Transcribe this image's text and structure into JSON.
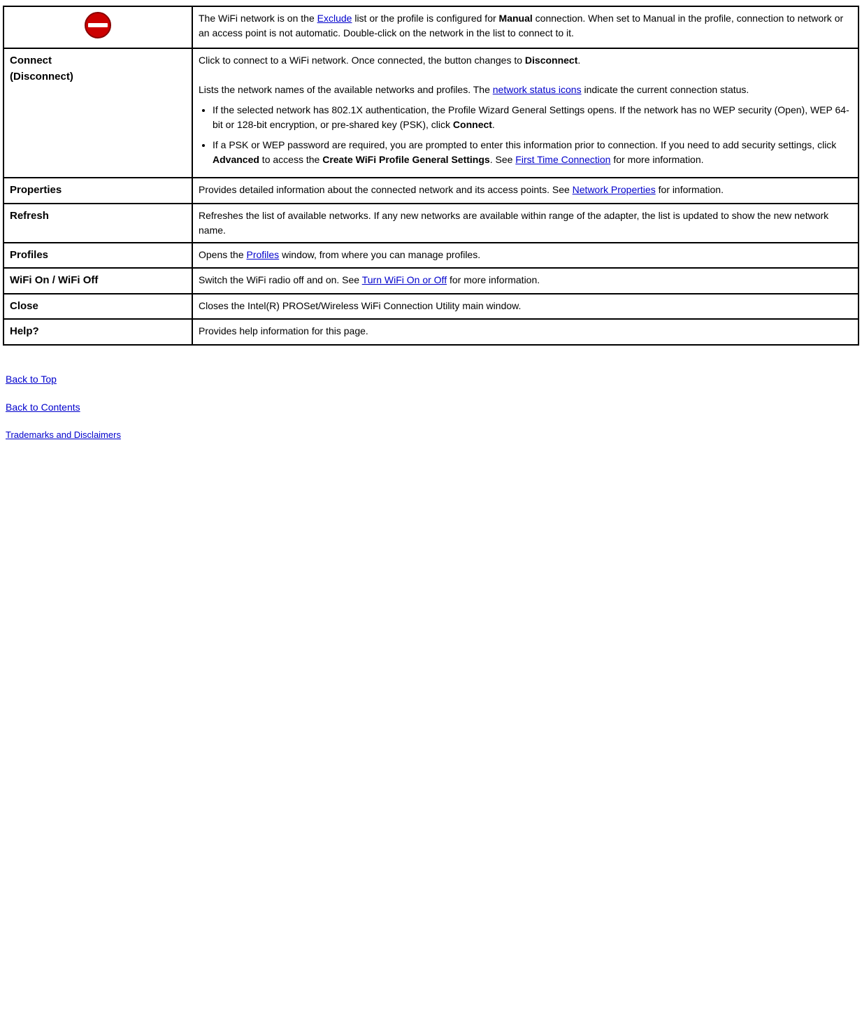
{
  "table": {
    "rows": [
      {
        "type": "icon-row",
        "icon_label": "no-entry-icon",
        "description_html": "The WiFi network is on the <a href='#'>Exclude</a> list or the profile is configured for <strong>Manual</strong> connection. When set to Manual in the profile, connection to network or an access point is not automatic. Double-click on the network in the list to connect to it."
      },
      {
        "type": "label-row",
        "label": "Connect (Disconnect)",
        "description_intro": "Click to connect to a WiFi network. Once connected, the button changes to",
        "description_disconnect": "Disconnect",
        "description_mid": "Lists the network names of the available networks and profiles. The",
        "description_link1_text": "network status icons",
        "description_link1_href": "#",
        "description_mid2": "indicate the current connection status.",
        "bullets": [
          "If the selected network has 802.1X authentication, the Profile Wizard General Settings opens. If the network has no WEP security (Open), WEP 64-bit or 128-bit encryption, or pre-shared key (PSK), click <strong>Connect</strong>.",
          "If a PSK or WEP password are required, you are prompted to enter this information prior to connection. If you need to add security settings, click <strong>Advanced</strong> to access the <strong>Create WiFi Profile General Settings</strong>. See <a href='#'>First Time Connection</a> for more information."
        ]
      },
      {
        "type": "label-row",
        "label": "Properties",
        "description": "Provides detailed information about the connected network and its access points. See",
        "link_text": "Network Properties",
        "link_href": "#",
        "description_suffix": "for information."
      },
      {
        "type": "label-row",
        "label": "Refresh",
        "description": "Refreshes the list of available networks. If any new networks are available within range of the adapter, the list is updated to show the new network name."
      },
      {
        "type": "label-row",
        "label": "Profiles",
        "description_pre": "Opens the",
        "link_text": "Profiles",
        "link_href": "#",
        "description_suffix": "window, from where you can manage profiles."
      },
      {
        "type": "label-row",
        "label": "WiFi On /  WiFi Off",
        "description_pre": "Switch the WiFi radio off and on. See",
        "link_text": "Turn WiFi On or Off",
        "link_href": "#",
        "description_suffix": "for more information."
      },
      {
        "type": "label-row",
        "label": "Close",
        "description": "Closes the Intel(R) PROSet/Wireless WiFi Connection Utility main window."
      },
      {
        "type": "label-row",
        "label": "Help?",
        "description": "Provides help information for this page."
      }
    ]
  },
  "footer": {
    "back_to_top": "Back to Top",
    "back_to_contents": "Back to Contents",
    "trademarks": "Trademarks and Disclaimers"
  }
}
